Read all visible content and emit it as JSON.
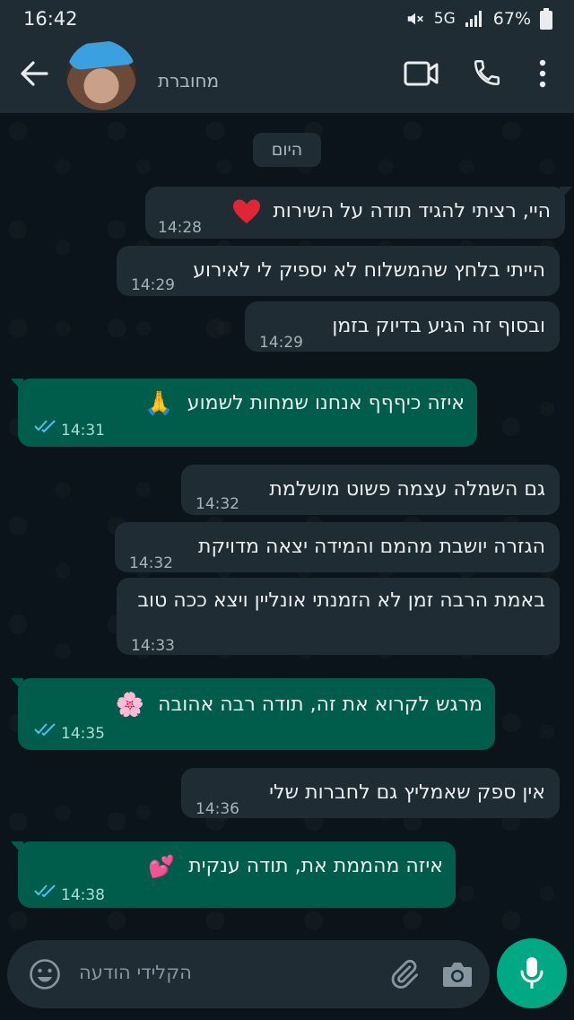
{
  "status_bar": {
    "time": "16:42",
    "network": "5G",
    "battery": "67%"
  },
  "header": {
    "contact_status": "מחוברת",
    "icons": [
      "back-arrow-icon",
      "video-call-icon",
      "phone-icon",
      "more-vert-icon"
    ]
  },
  "chat": {
    "date_label": "היום",
    "messages": [
      {
        "dir": "in",
        "text": "היי, רציתי להגיד תודה על השירות",
        "emoji": "heart",
        "time": "14:28"
      },
      {
        "dir": "in",
        "text": "הייתי בלחץ שהמשלוח לא יספיק לי לאירוע",
        "time": "14:29"
      },
      {
        "dir": "in",
        "text": "ובסוף זה הגיע בדיוק בזמן",
        "time": "14:29"
      },
      {
        "dir": "out",
        "text": "איזה כיףףף אנחנו שמחות לשמוע",
        "emoji": "pray",
        "time": "14:31",
        "read": true
      },
      {
        "dir": "in",
        "text": "גם השמלה עצמה פשוט מושלמת",
        "time": "14:32"
      },
      {
        "dir": "in",
        "text": "הגזרה יושבת מהמם והמידה יצאה מדויקת",
        "time": "14:32"
      },
      {
        "dir": "in",
        "text": "באמת הרבה זמן לא הזמנתי אונליין ויצא ככה טוב",
        "time": "14:33"
      },
      {
        "dir": "out",
        "text": "מרגש לקרוא את זה, תודה רבה אהובה",
        "emoji": "blossom",
        "time": "14:35",
        "read": true
      },
      {
        "dir": "in",
        "text": "אין ספק שאמליץ גם לחברות שלי",
        "time": "14:36"
      },
      {
        "dir": "out",
        "text": "איזה מהממת את, תודה ענקית",
        "emoji": "hearts",
        "time": "14:38",
        "read": true
      }
    ]
  },
  "input": {
    "placeholder": "הקלידי הודעה",
    "icons": [
      "emoji-icon",
      "attach-icon",
      "camera-icon",
      "mic-icon"
    ]
  },
  "colors": {
    "background": "#0b141a",
    "bar": "#1f2c33",
    "incoming_bubble": "#1f2c33",
    "outgoing_bubble": "#005c4b",
    "accent": "#00a884",
    "read_ticks": "#53bdeb"
  }
}
